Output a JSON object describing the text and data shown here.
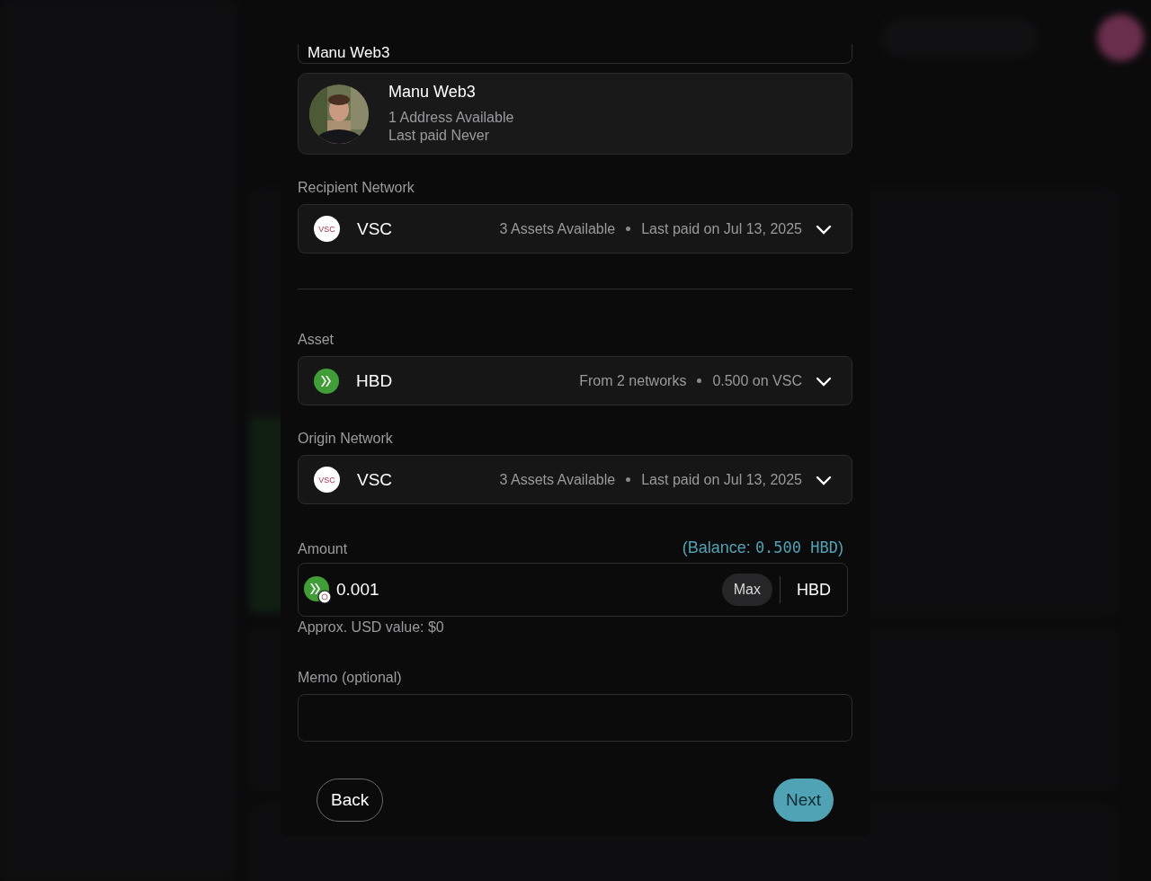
{
  "recipient_search": {
    "value": "Manu Web3"
  },
  "contact": {
    "name": "Manu Web3",
    "addresses": "1 Address Available",
    "last_paid": "Last paid Never"
  },
  "selectors": [
    {
      "label": "Recipient Network",
      "kind": "network",
      "logo_text": "VSC",
      "name": "VSC",
      "info": "3 Assets Available",
      "detail": "Last paid on Jul 13, 2025"
    },
    {
      "label": "Asset",
      "kind": "token",
      "name": "HBD",
      "info": "From 2 networks",
      "detail": "0.500 on VSC"
    },
    {
      "label": "Origin Network",
      "kind": "network",
      "logo_text": "VSC",
      "name": "VSC",
      "info": "3 Assets Available",
      "detail": "Last paid on Jul 13, 2025"
    }
  ],
  "amount": {
    "label": "Amount",
    "balance_prefix": "(Balance:",
    "balance_value": "0.500 HBD",
    "balance_suffix": ")",
    "value": "0.001",
    "max_button": "Max",
    "unit": "HBD",
    "usd_hint": "Approx. USD value: $0"
  },
  "memo": {
    "label": "Memo (optional)"
  },
  "buttons": {
    "back": "Back",
    "next": "Next"
  }
}
